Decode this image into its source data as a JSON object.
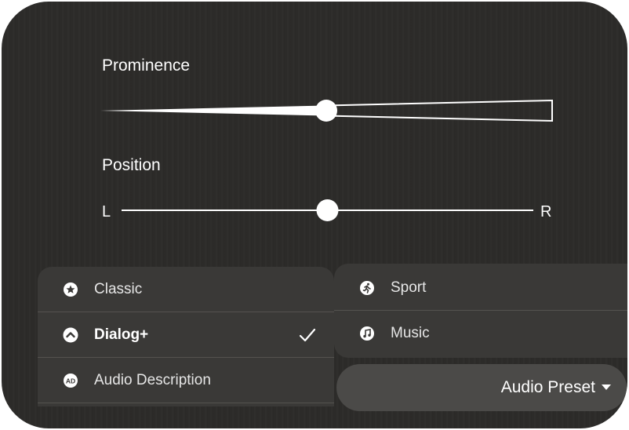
{
  "prominence": {
    "label": "Prominence",
    "value": 0.5
  },
  "position": {
    "label": "Position",
    "left_label": "L",
    "right_label": "R",
    "value": 0.5
  },
  "preset_menu": {
    "left_items": [
      {
        "label": "Classic",
        "icon": "star-circle-icon",
        "selected": false
      },
      {
        "label": "Dialog+",
        "icon": "chevron-up-circle-icon",
        "selected": true
      },
      {
        "label": "Audio Description",
        "icon": "ad-circle-icon",
        "selected": false
      }
    ],
    "right_items": [
      {
        "label": "Sport",
        "icon": "runner-circle-icon"
      },
      {
        "label": "Music",
        "icon": "music-note-circle-icon"
      }
    ]
  },
  "preset_button": {
    "label": "Audio Preset",
    "icon": "caret-down-icon"
  },
  "colors": {
    "background": "#2c2b29",
    "menu": "#3a3937",
    "button": "#4b4a48",
    "foreground": "#ffffff"
  }
}
